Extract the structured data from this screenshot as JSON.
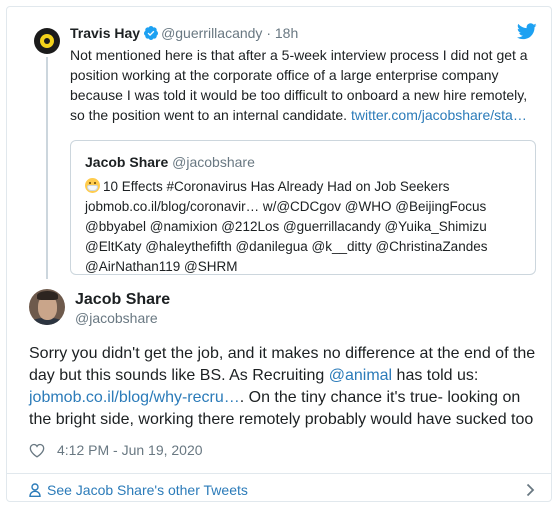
{
  "parent_tweet": {
    "author_name": "Travis Hay",
    "handle": "@guerrillacandy",
    "separator": "·",
    "time": "18h",
    "text": "Not mentioned here is that after a 5-week interview process I did not get a position working at the corporate office of a large enterprise company because I was told it would be too difficult to onboard a new hire remotely, so the position went to an internal candidate.",
    "link_text": "twitter.com/jacobshare/sta…"
  },
  "quoted_tweet": {
    "author_name": "Jacob Share",
    "handle": "@jacobshare",
    "text": "10 Effects #Coronavirus Has Already Had on Job Seekers jobmob.co.il/blog/coronavir… w/@CDCgov @WHO @BeijingFocus @bbyabel @namixion @212Los @guerrillacandy @Yuika_Shimizu @EltKaty @haleythefifth @danilegua @k__ditty @ChristinaZandes @AirNathan119 @SHRM"
  },
  "main_tweet": {
    "author_name": "Jacob Share",
    "handle": "@jacobshare",
    "text_part1": "Sorry you didn't get the job, and it makes no difference at the end of the day but this sounds like BS. As Recruiting ",
    "mention": "@animal",
    "text_part2": " has told us: ",
    "link_text": "jobmob.co.il/blog/why-recru…",
    "text_part3": ". On the tiny chance it's true- looking on the bright side, working there remotely probably would have sucked too",
    "timestamp": "4:12 PM - Jun 19, 2020"
  },
  "footer": {
    "link_label": "See Jacob Share's other Tweets"
  },
  "icons": {
    "verified": "verified-badge-icon",
    "brand": "twitter-bird-icon",
    "like": "heart-icon",
    "profile": "person-icon",
    "more": "chevron-right-icon"
  },
  "colors": {
    "link": "#2b7bb9",
    "brand": "#1da1f2",
    "secondary_text": "#697882",
    "border": "#e1e8ed"
  }
}
